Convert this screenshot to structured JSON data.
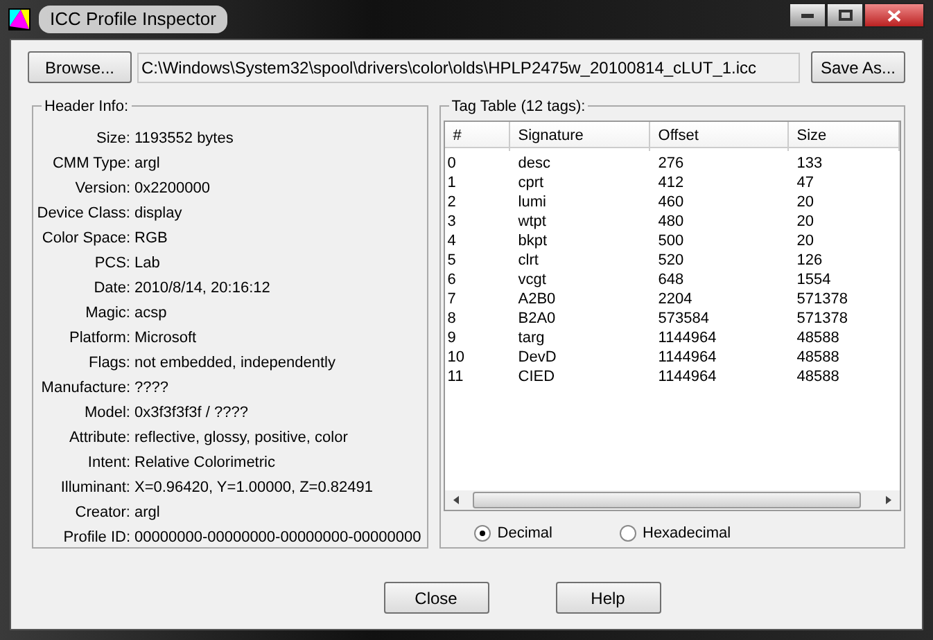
{
  "window": {
    "title": "ICC Profile Inspector"
  },
  "browse_button": "Browse...",
  "file_path": "C:\\Windows\\System32\\spool\\drivers\\color\\olds\\HPLP2475w_20100814_cLUT_1.icc",
  "save_button": "Save As...",
  "header_info": {
    "title": "Header Info:",
    "fields": [
      {
        "label": "Size:",
        "value": "1193552 bytes"
      },
      {
        "label": "CMM Type:",
        "value": "argl"
      },
      {
        "label": "Version:",
        "value": "0x2200000"
      },
      {
        "label": "Device Class:",
        "value": "display"
      },
      {
        "label": "Color Space:",
        "value": "RGB"
      },
      {
        "label": "PCS:",
        "value": "Lab"
      },
      {
        "label": "Date:",
        "value": "2010/8/14, 20:16:12"
      },
      {
        "label": "Magic:",
        "value": "acsp"
      },
      {
        "label": "Platform:",
        "value": "Microsoft"
      },
      {
        "label": "Flags:",
        "value": "not embedded, independently"
      },
      {
        "label": "Manufacture:",
        "value": "????"
      },
      {
        "label": "Model:",
        "value": "0x3f3f3f3f / ????"
      },
      {
        "label": "Attribute:",
        "value": "reflective, glossy, positive, color"
      },
      {
        "label": "Intent:",
        "value": "Relative Colorimetric"
      },
      {
        "label": "Illuminant:",
        "value": "X=0.96420, Y=1.00000, Z=0.82491"
      },
      {
        "label": "Creator:",
        "value": "argl"
      },
      {
        "label": "Profile ID:",
        "value": "00000000-00000000-00000000-00000000"
      }
    ]
  },
  "tag_table": {
    "title": "Tag Table (12 tags):",
    "columns": [
      "#",
      "Signature",
      "Offset",
      "Size"
    ],
    "rows": [
      [
        "0",
        "desc",
        "276",
        "133"
      ],
      [
        "1",
        "cprt",
        "412",
        "47"
      ],
      [
        "2",
        "lumi",
        "460",
        "20"
      ],
      [
        "3",
        "wtpt",
        "480",
        "20"
      ],
      [
        "4",
        "bkpt",
        "500",
        "20"
      ],
      [
        "5",
        "clrt",
        "520",
        "126"
      ],
      [
        "6",
        "vcgt",
        "648",
        "1554"
      ],
      [
        "7",
        "A2B0",
        "2204",
        "571378"
      ],
      [
        "8",
        "B2A0",
        "573584",
        "571378"
      ],
      [
        "9",
        "targ",
        "1144964",
        "48588"
      ],
      [
        "10",
        "DevD",
        "1144964",
        "48588"
      ],
      [
        "11",
        "CIED",
        "1144964",
        "48588"
      ]
    ],
    "number_format": [
      {
        "label": "Decimal",
        "selected": true
      },
      {
        "label": "Hexadecimal",
        "selected": false
      }
    ]
  },
  "buttons": [
    "Close",
    "Help"
  ]
}
